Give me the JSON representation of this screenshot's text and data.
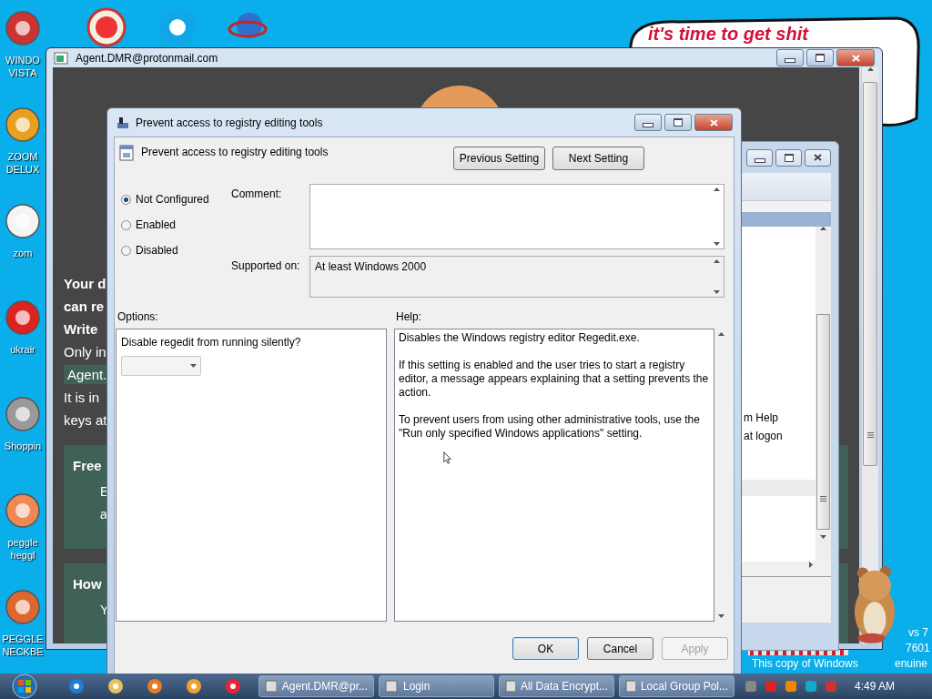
{
  "desktop": {
    "icons": [
      {
        "label_lines": [
          "WINDO",
          "VISTA"
        ]
      },
      {
        "label_lines": [
          "ZOOM",
          "DELUX"
        ]
      },
      {
        "label_lines": [
          "zom"
        ]
      },
      {
        "label_lines": [
          "ukrair"
        ]
      },
      {
        "label_lines": [
          "Shoppin"
        ]
      },
      {
        "label_lines": [
          "peggle",
          "heggl"
        ]
      },
      {
        "label_lines": [
          "PEGGLE",
          "NECKBE"
        ]
      }
    ],
    "bubble_text": "it's time to get shit",
    "notice_lines": [
      "vs 7",
      "7601",
      "This copy of Windows",
      "enuine"
    ]
  },
  "ransom_window": {
    "title": "Agent.DMR@protonmail.com",
    "lines": [
      {
        "kind": "bold",
        "text": "Your d"
      },
      {
        "kind": "bold",
        "text": "can re"
      },
      {
        "kind": "bold",
        "text": "Write"
      },
      {
        "kind": "plain",
        "text": "Only in"
      },
      {
        "kind": "highlight",
        "text": "Agent."
      },
      {
        "kind": "plain",
        "text": "It is in"
      },
      {
        "kind": "plain",
        "text": "keys at"
      }
    ],
    "panels": [
      {
        "title": "Free",
        "lines": [
          "E",
          "a"
        ]
      },
      {
        "title": "How",
        "lines": [
          "Y"
        ]
      }
    ]
  },
  "back_window": {
    "lines": [
      "m Help",
      "at logon"
    ]
  },
  "dialog": {
    "title": "Prevent access to registry editing tools",
    "header": "Prevent access to registry editing tools",
    "nav_buttons": [
      "Previous Setting",
      "Next Setting"
    ],
    "radios": [
      {
        "label": "Not Configured",
        "selected": true
      },
      {
        "label": "Enabled",
        "selected": false
      },
      {
        "label": "Disabled",
        "selected": false
      }
    ],
    "comment_label": "Comment:",
    "supported_label": "Supported on:",
    "supported_value": "At least Windows 2000",
    "options_label": "Options:",
    "help_label": "Help:",
    "option_prompt": "Disable regedit from running silently?",
    "option_dropdown": {
      "disabled": true
    },
    "help_paragraphs": [
      "Disables the Windows registry editor Regedit.exe.",
      "If this setting is enabled and the user tries to start a registry editor, a message appears explaining that a setting prevents the action.",
      "To prevent users from using other administrative tools, use the \"Run only specified Windows applications\" setting."
    ],
    "buttons": [
      {
        "label": "OK",
        "disabled": false,
        "default": true
      },
      {
        "label": "Cancel",
        "disabled": false,
        "default": false
      },
      {
        "label": "Apply",
        "disabled": true,
        "default": false
      }
    ]
  },
  "taskbar": {
    "tasks": [
      "Agent.DMR@pr...",
      "Login",
      "All Data Encrypt...",
      "Local Group Pol..."
    ],
    "time": "4:49 AM"
  }
}
